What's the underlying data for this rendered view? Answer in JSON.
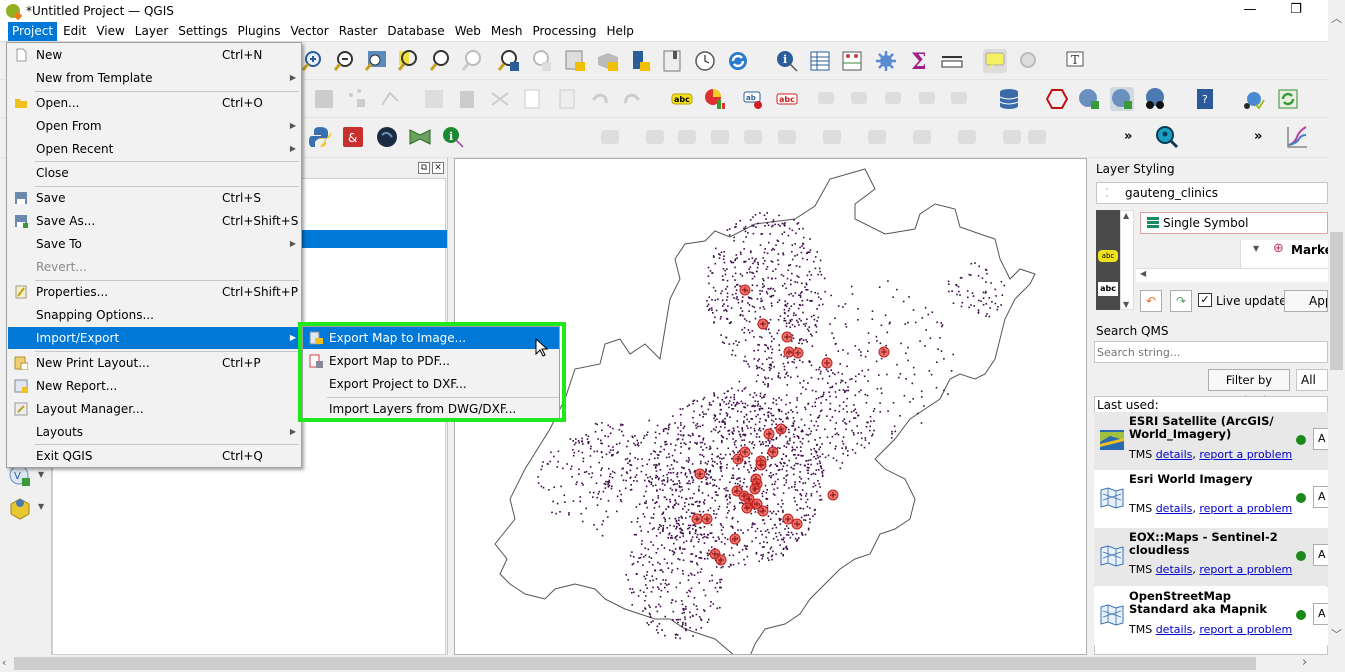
{
  "window": {
    "title": "*Untitled Project — QGIS",
    "minimize_icon": "minimize-icon",
    "restore_icon": "restore-icon"
  },
  "menubar": {
    "items": [
      "Project",
      "Edit",
      "View",
      "Layer",
      "Settings",
      "Plugins",
      "Vector",
      "Raster",
      "Database",
      "Web",
      "Mesh",
      "Processing",
      "Help"
    ],
    "active": "Project"
  },
  "project_menu": {
    "items": [
      {
        "label": "New",
        "shortcut": "Ctrl+N",
        "icon": "new-file-icon"
      },
      {
        "label": "New from Template",
        "submenu": true
      },
      {
        "label": "Open...",
        "shortcut": "Ctrl+O",
        "icon": "folder-icon"
      },
      {
        "label": "Open From",
        "submenu": true
      },
      {
        "label": "Open Recent",
        "submenu": true
      },
      {
        "label": "Close"
      },
      {
        "label": "Save",
        "shortcut": "Ctrl+S",
        "icon": "save-icon"
      },
      {
        "label": "Save As...",
        "shortcut": "Ctrl+Shift+S",
        "icon": "save-as-icon"
      },
      {
        "label": "Save To",
        "submenu": true
      },
      {
        "label": "Revert...",
        "disabled": true
      },
      {
        "label": "Properties...",
        "shortcut": "Ctrl+Shift+P",
        "icon": "properties-icon"
      },
      {
        "label": "Snapping Options..."
      },
      {
        "label": "Import/Export",
        "submenu": true,
        "highlighted": true
      },
      {
        "label": "New Print Layout...",
        "shortcut": "Ctrl+P",
        "icon": "print-layout-icon"
      },
      {
        "label": "New Report...",
        "icon": "report-icon"
      },
      {
        "label": "Layout Manager...",
        "icon": "layout-manager-icon"
      },
      {
        "label": "Layouts",
        "submenu": true
      },
      {
        "label": "Exit QGIS",
        "shortcut": "Ctrl+Q"
      }
    ]
  },
  "import_export_submenu": {
    "items": [
      {
        "label": "Export Map to Image...",
        "highlighted": true,
        "icon": "export-image-icon"
      },
      {
        "label": "Export Map to PDF...",
        "icon": "export-pdf-icon"
      },
      {
        "label": "Export Project to DXF..."
      },
      {
        "label": "Import Layers from DWG/DXF..."
      }
    ]
  },
  "toolbar_overflow": "»",
  "layer_styling": {
    "title": "Layer Styling",
    "layer": "gauteng_clinics",
    "renderer": "Single Symbol",
    "symbol_tree_item": "Marke",
    "live_update_label": "Live update",
    "live_update_checked": true,
    "apply_label": "App"
  },
  "search_qms": {
    "title": "Search QMS",
    "placeholder": "Search string...",
    "filter_button": "Filter by extent",
    "filter_select": "All",
    "last_used_label": "Last used:",
    "services": [
      {
        "name": "ESRI Satellite (ArcGIS/ World_Imagery)",
        "type": "TMS",
        "details": "details",
        "report": "report a problem",
        "status_color": "#1a8a1a",
        "add_label": "A"
      },
      {
        "name": "Esri World Imagery",
        "type": "TMS",
        "details": "details",
        "report": "report a problem",
        "status_color": "#1a8a1a",
        "add_label": "A"
      },
      {
        "name": "EOX::Maps - Sentinel-2 cloudless",
        "type": "TMS",
        "details": "details",
        "report": "report a problem",
        "status_color": "#1a8a1a",
        "add_label": "A"
      },
      {
        "name": "OpenStreetMap Standard aka Mapnik",
        "type": "TMS",
        "details": "details",
        "report": "report a problem",
        "status_color": "#1a8a1a",
        "add_label": "A"
      }
    ]
  },
  "colors": {
    "accent": "#0078d7",
    "highlight_box": "#1ee81e",
    "map_points": "#3b0a45",
    "clinic_markers": "#e8463c"
  }
}
